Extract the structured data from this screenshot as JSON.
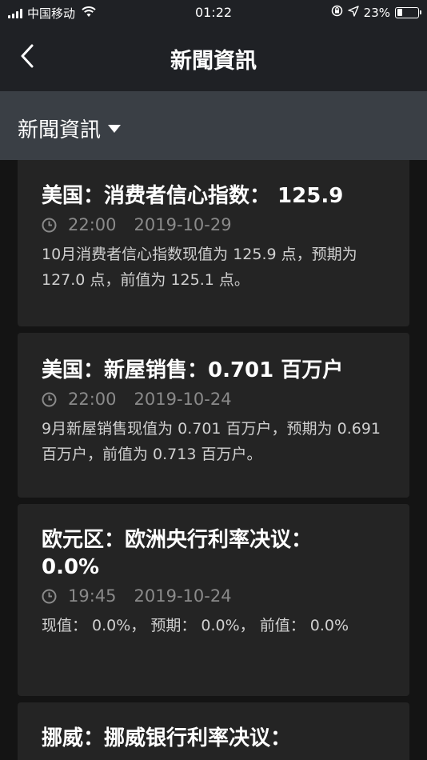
{
  "status_bar": {
    "carrier": "中国移动",
    "time": "01:22",
    "battery_percent": "23%",
    "battery_level": 0.23,
    "icons": [
      "signal-icon",
      "wifi-icon",
      "rotation-lock-icon",
      "location-icon",
      "battery-icon"
    ]
  },
  "nav": {
    "back_icon": "chevron-left-icon",
    "title": "新聞資訊"
  },
  "category": {
    "label": "新聞資訊",
    "icon": "caret-down-icon"
  },
  "news": [
    {
      "title": "美国：消费者信心指数： 125.9",
      "time": "22:00",
      "date": "2019-10-29",
      "body": "10月消费者信心指数现值为 125.9 点，预期为 127.0 点，前值为 125.1 点。"
    },
    {
      "title": "美国：新屋销售：0.701 百万户",
      "time": "22:00",
      "date": "2019-10-24",
      "body": "9月新屋销售现值为 0.701 百万户，预期为 0.691 百万户，前值为 0.713 百万户。"
    },
    {
      "title": "欧元区：欧洲央行利率决议： 0.0%",
      "time": "19:45",
      "date": "2019-10-24",
      "body": "现值： 0.0%， 预期： 0.0%， 前值： 0.0%"
    },
    {
      "title": "挪威：挪威银行利率决议："
    }
  ],
  "colors": {
    "bar_background": "#1f2125",
    "category_background": "#3a3f45",
    "card_background": "#242424",
    "page_background": "#141414",
    "meta_text": "#8a8a8a"
  }
}
